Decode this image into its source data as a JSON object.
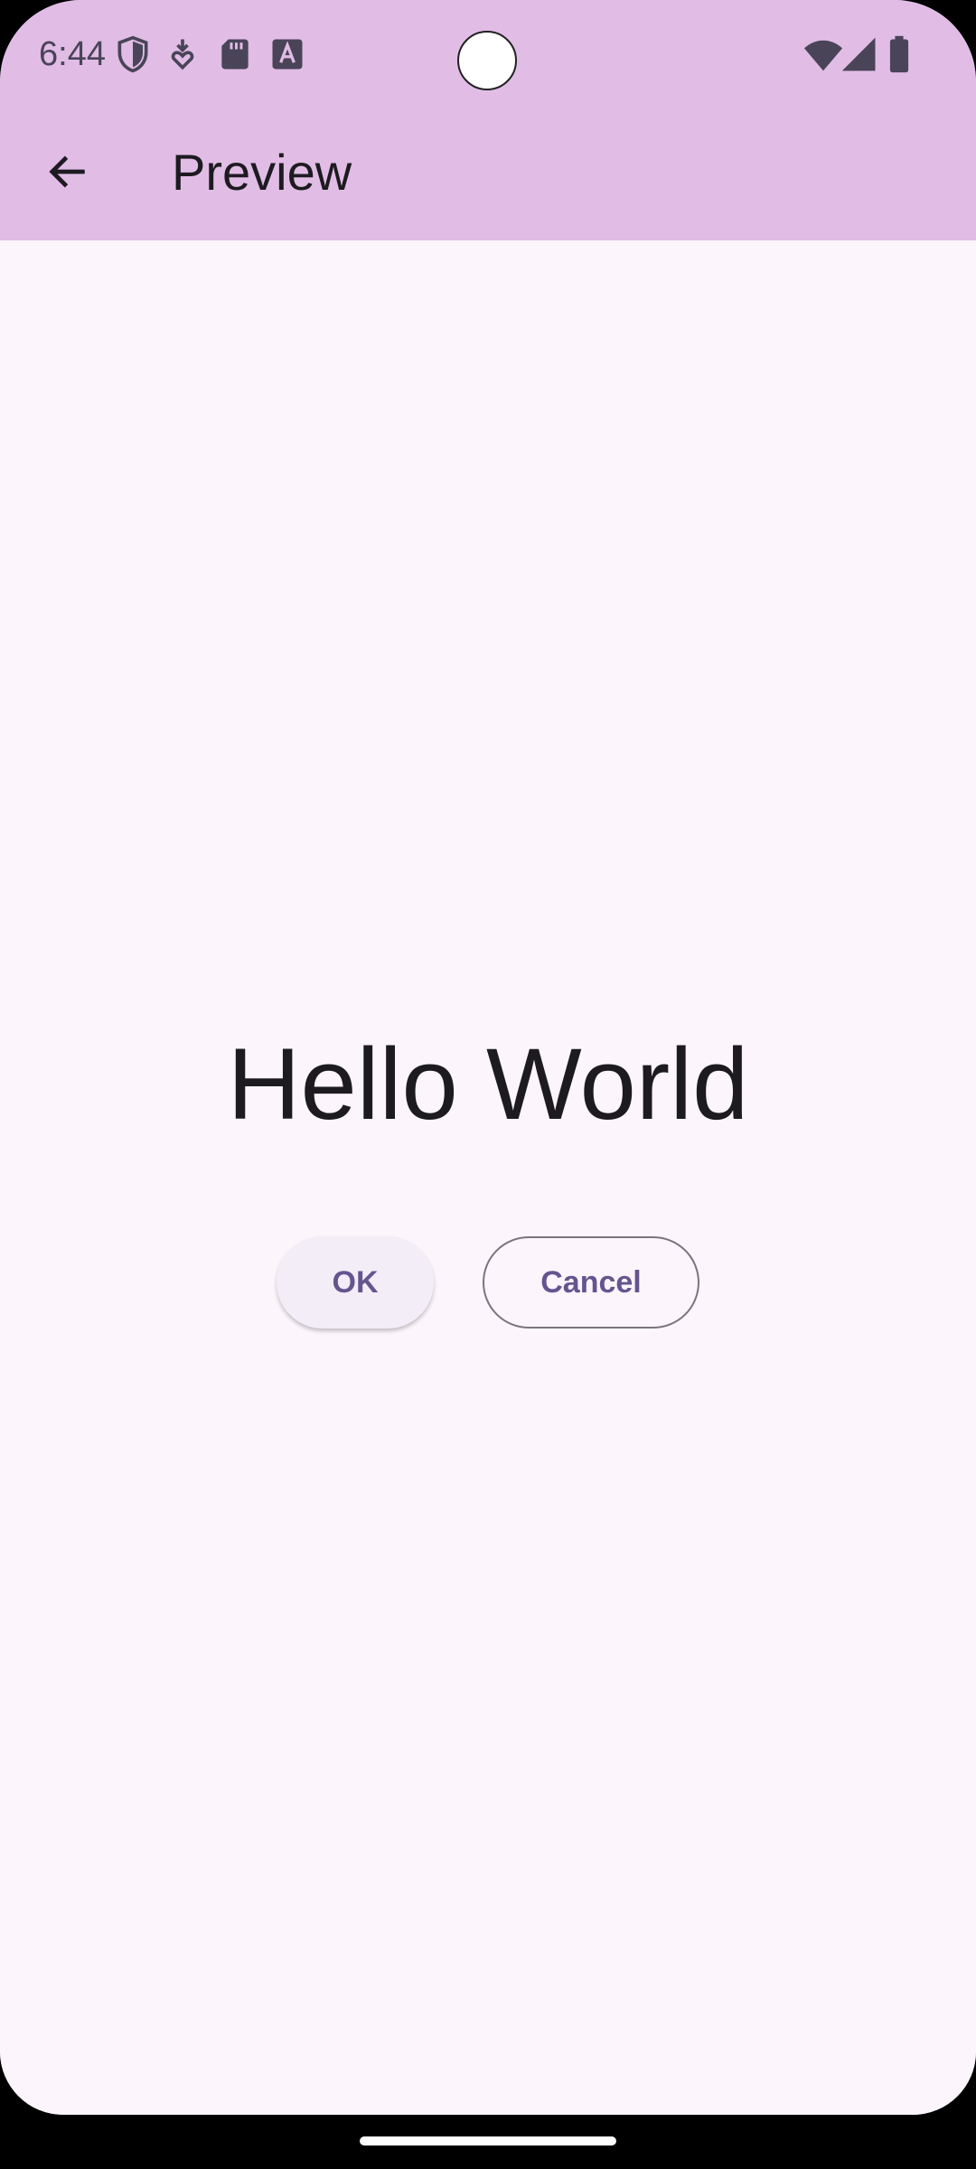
{
  "status_bar": {
    "time": "6:44",
    "left_icons": [
      "shield-icon",
      "heart-download-icon",
      "sd-card-icon",
      "text-a-icon"
    ],
    "right_icons": [
      "wifi-icon",
      "signal-icon",
      "battery-icon"
    ]
  },
  "app_bar": {
    "back_icon": "arrow-back-icon",
    "title": "Preview",
    "background": "#E1BDE6"
  },
  "main": {
    "heading": "Hello World",
    "ok_label": "OK",
    "cancel_label": "Cancel"
  },
  "colors": {
    "background": "#FCF6FC",
    "primary_text": "#1D1B20",
    "accent": "#65558F",
    "outline": "#79747E"
  }
}
